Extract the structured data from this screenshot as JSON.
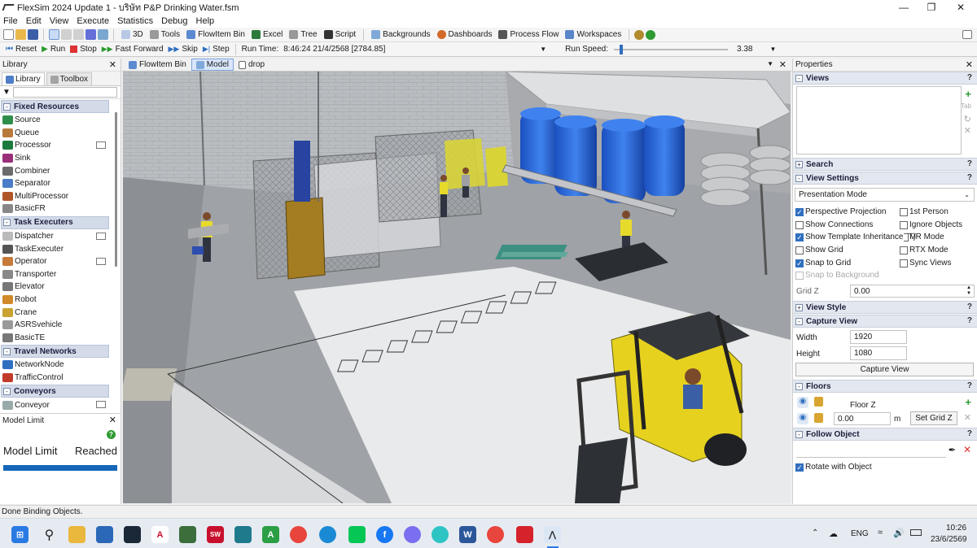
{
  "window": {
    "title": "FlexSim 2024 Update 1 - บริษัท P&P Drinking Water.fsm"
  },
  "menu": [
    "File",
    "Edit",
    "View",
    "Execute",
    "Statistics",
    "Debug",
    "Help"
  ],
  "toolbar1": {
    "items": [
      "3D",
      "Tools",
      "FlowItem Bin",
      "Excel",
      "Tree",
      "Script",
      "Backgrounds",
      "Dashboards",
      "Process Flow",
      "Workspaces"
    ]
  },
  "toolbar2": {
    "reset": "Reset",
    "run": "Run",
    "stop": "Stop",
    "fast_forward": "Fast Forward",
    "skip": "Skip",
    "step": "Step",
    "run_time_label": "Run Time:",
    "run_time_value": "8:46:24  21/4/2568  [2784.85]",
    "run_speed_label": "Run Speed:",
    "run_speed_value": "3.38",
    "run_speed_fraction": 0.05
  },
  "library": {
    "title": "Library",
    "tabs": [
      "Library",
      "Toolbox"
    ],
    "categories": [
      {
        "name": "Fixed Resources",
        "items": [
          "Source",
          "Queue",
          "Processor",
          "Sink",
          "Combiner",
          "Separator",
          "MultiProcessor",
          "BasicFR"
        ]
      },
      {
        "name": "Task Executers",
        "items": [
          "Dispatcher",
          "TaskExecuter",
          "Operator",
          "Transporter",
          "Elevator",
          "Robot",
          "Crane",
          "ASRSvehicle",
          "BasicTE"
        ]
      },
      {
        "name": "Travel Networks",
        "items": [
          "NetworkNode",
          "TrafficControl"
        ]
      },
      {
        "name": "Conveyors",
        "items": [
          "Conveyor"
        ]
      }
    ]
  },
  "model_limit": {
    "title": "Model Limit",
    "label": "Model Limit",
    "status": "Reached"
  },
  "doc_tabs": [
    "FlowItem Bin",
    "Model",
    "drop"
  ],
  "properties": {
    "title": "Properties",
    "views_label": "Views",
    "search_label": "Search",
    "view_settings_label": "View Settings",
    "mode_select": "Presentation Mode",
    "checkboxes": {
      "perspective": "Perspective Projection",
      "first_person": "1st Person",
      "show_connections": "Show Connections",
      "ignore_objects": "Ignore Objects",
      "template_inheritance": "Show Template Inheritance (T)",
      "vr_mode": "VR Mode",
      "show_grid": "Show Grid",
      "rtx_mode": "RTX Mode",
      "snap_to_grid": "Snap to Grid",
      "sync_views": "Sync Views",
      "snap_to_background": "Snap to Background"
    },
    "grid_z_label": "Grid Z",
    "grid_z_value": "0.00",
    "view_style_label": "View Style",
    "capture_view_label": "Capture View",
    "width_label": "Width",
    "width_value": "1920",
    "height_label": "Height",
    "height_value": "1080",
    "capture_button": "Capture View",
    "floors_label": "Floors",
    "floor_name": "Floor Z",
    "floor_value": "0.00",
    "floor_unit": "m",
    "set_grid_button": "Set Grid Z",
    "follow_object_label": "Follow Object",
    "rotate_with_object": "Rotate with Object"
  },
  "status_bar": "Done Binding Objects.",
  "taskbar": {
    "lang": "ENG",
    "time": "10:26",
    "date": "23/6/2569"
  }
}
